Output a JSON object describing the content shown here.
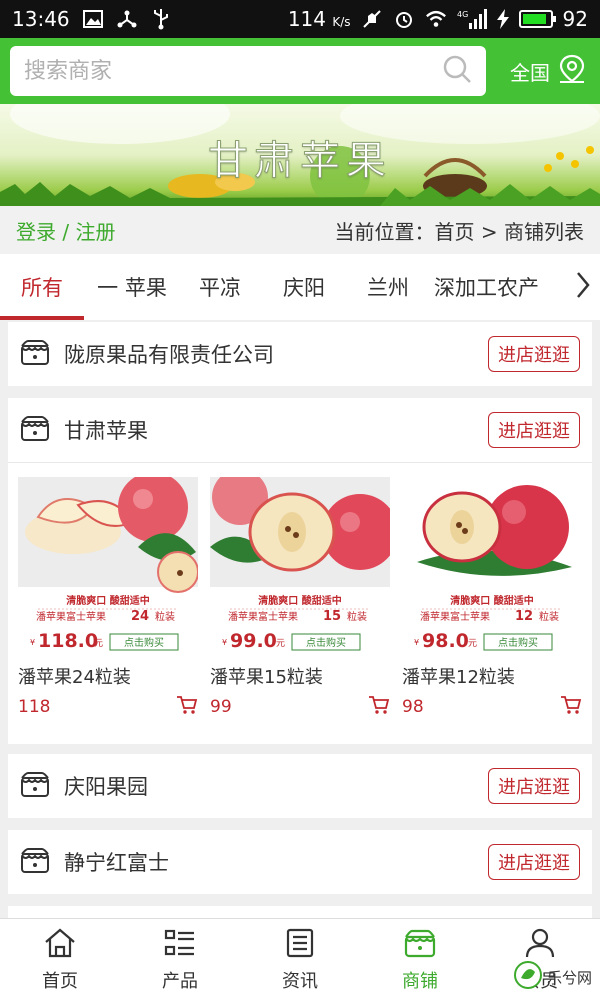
{
  "status_bar": {
    "time": "13:46",
    "speed": "114",
    "speed_unit": "K/s",
    "network": "4G",
    "battery": "92",
    "battery_level": 0.92
  },
  "header": {
    "search_placeholder": "搜索商家",
    "region": "全国"
  },
  "banner": {
    "title": "甘肃苹果"
  },
  "crumb": {
    "login": "登录 / 注册",
    "location": "当前位置：首页 > 商铺列表"
  },
  "tabs": [
    "所有",
    "一 苹果",
    "平凉",
    "庆阳",
    "兰州",
    "深加工农产"
  ],
  "stores": [
    {
      "name": "陇原果品有限责任公司",
      "button": "进店逛逛"
    },
    {
      "name": "甘肃苹果",
      "button": "进店逛逛",
      "products": [
        {
          "name": "潘苹果24粒装",
          "price": "118",
          "promo": {
            "tag": "清脆爽口 酸甜适中",
            "line": "潘苹果富士苹果",
            "count": "24",
            "unit": "粒装",
            "price": "118.0",
            "yuan": "元",
            "buy": "点击购买"
          }
        },
        {
          "name": "潘苹果15粒装",
          "price": "99",
          "promo": {
            "tag": "清脆爽口 酸甜适中",
            "line": "潘苹果富士苹果",
            "count": "15",
            "unit": "粒装",
            "price": "99.0",
            "yuan": "元",
            "buy": "点击购买"
          }
        },
        {
          "name": "潘苹果12粒装",
          "price": "98",
          "promo": {
            "tag": "清脆爽口 酸甜适中",
            "line": "潘苹果富士苹果",
            "count": "12",
            "unit": "粒装",
            "price": "98.0",
            "yuan": "元",
            "buy": "点击购买"
          }
        }
      ]
    },
    {
      "name": "庆阳果园",
      "button": "进店逛逛"
    },
    {
      "name": "静宁红富士",
      "button": "进店逛逛"
    }
  ],
  "tabbar": [
    {
      "label": "首页",
      "icon": "home-icon"
    },
    {
      "label": "产品",
      "icon": "list-icon"
    },
    {
      "label": "资讯",
      "icon": "news-icon"
    },
    {
      "label": "商铺",
      "icon": "shop-icon",
      "active": true
    },
    {
      "label": "会员",
      "icon": "user-icon"
    }
  ],
  "watermark": {
    "text": "乐兮网"
  },
  "colors": {
    "brand_green": "#45c136",
    "accent_red": "#c0282e",
    "active_green": "#3daa2d"
  }
}
